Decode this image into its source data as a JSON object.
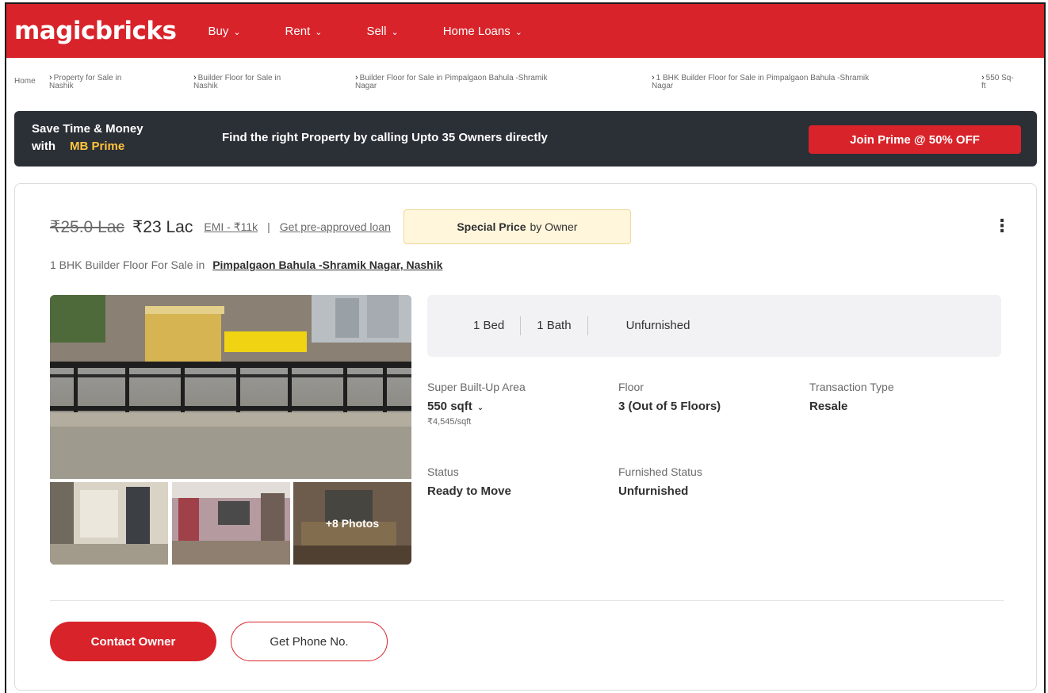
{
  "header": {
    "logo": "magicbricks",
    "nav": [
      {
        "label": "Buy"
      },
      {
        "label": "Rent"
      },
      {
        "label": "Sell"
      },
      {
        "label": "Home Loans"
      }
    ]
  },
  "breadcrumb": [
    {
      "label": "Home",
      "sep": ""
    },
    {
      "label": "Property for Sale in\nNashik",
      "sep": "›"
    },
    {
      "label": "Builder Floor for Sale in\nNashik",
      "sep": "›"
    },
    {
      "label": "Builder Floor for Sale in Pimpalgaon Bahula -Shramik\nNagar",
      "sep": "›"
    },
    {
      "label": "1 BHK Builder Floor for Sale in Pimpalgaon Bahula -Shramik\nNagar",
      "sep": "›"
    },
    {
      "label": "550 Sq-\nft",
      "sep": "›"
    }
  ],
  "prime_banner": {
    "line1": "Save Time & Money",
    "line2_prefix": "with",
    "brand": "MB Prime",
    "message": "Find the right Property by calling Upto 35 Owners directly",
    "cta": "Join Prime @ 50% OFF",
    "accent": "#ffc43d"
  },
  "listing": {
    "old_price": "₹25.0 Lac",
    "price": "₹23 Lac",
    "emi": "EMI - ₹11k",
    "divider": "|",
    "loan_link": "Get pre-approved loan",
    "special_strong": "Special Price",
    "special_rest": "by Owner",
    "title_prefix": "1 BHK Builder Floor For Sale in",
    "location": "Pimpalgaon Bahula -Shramik Nagar, Nashik",
    "more_photos": "+8 Photos",
    "summary": {
      "bed": "1 Bed",
      "bath": "1 Bath",
      "furnishing": "Unfurnished"
    },
    "details": {
      "area_label": "Super Built-Up Area",
      "area_value": "550 sqft",
      "area_rate": "₹4,545/sqft",
      "floor_label": "Floor",
      "floor_value": "3 (Out of 5 Floors)",
      "transaction_label": "Transaction Type",
      "transaction_value": "Resale",
      "status_label": "Status",
      "status_value": "Ready to Move",
      "furnished_label": "Furnished Status",
      "furnished_value": "Unfurnished"
    },
    "contact_button": "Contact Owner",
    "phone_button": "Get Phone No."
  },
  "colors": {
    "brand_red": "#d8232a",
    "banner_dark": "#2b2f36"
  }
}
